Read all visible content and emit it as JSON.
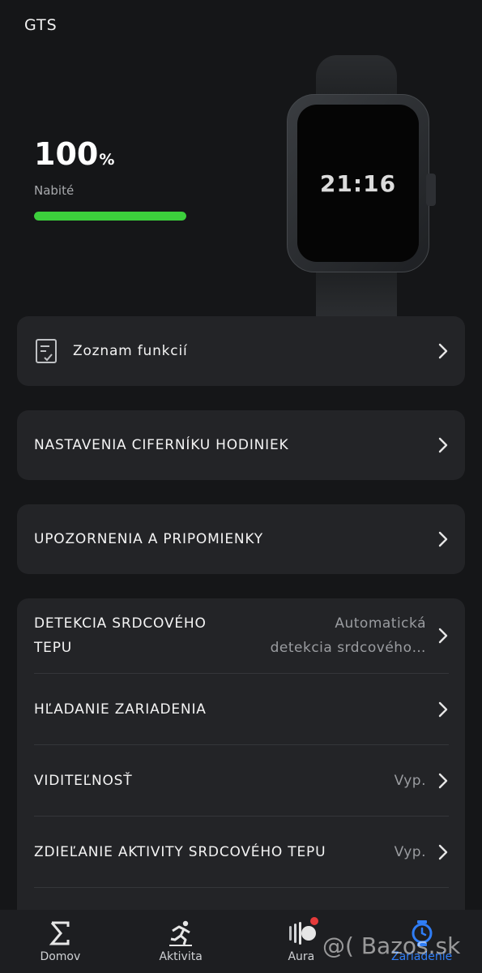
{
  "header": {
    "title": "GTS"
  },
  "battery": {
    "value": "100",
    "unit": "%",
    "label": "Nabité",
    "level": 1.0,
    "bar_color": "#3ccf3c"
  },
  "watch": {
    "time": "21:16"
  },
  "cards": {
    "features": {
      "label": "Zoznam funkcií"
    },
    "watchface": {
      "label": "NASTAVENIA CIFERNÍKU HODINIEK"
    },
    "notifications": {
      "label": "UPOZORNENIA A PRIPOMIENKY"
    }
  },
  "settings": {
    "heart_rate": {
      "label_line1": "DETEKCIA SRDCOVÉHO",
      "label_line2": "TEPU",
      "value_line1": "Automatická",
      "value_line2": "detekcia srdcového…"
    },
    "find_device": {
      "label": "HĽADANIE ZARIADENIA"
    },
    "visibility": {
      "label": "VIDITEĽNOSŤ",
      "value": "Vyp."
    },
    "share_hr": {
      "label": "ZDIEĽANIE AKTIVITY SRDCOVÉHO TEPU",
      "value": "Vyp."
    }
  },
  "nav": {
    "items": [
      {
        "label": "Domov",
        "icon": "sigma-icon"
      },
      {
        "label": "Aktivita",
        "icon": "runner-icon"
      },
      {
        "label": "Aura",
        "icon": "aura-icon"
      },
      {
        "label": "Zariadenie",
        "icon": "watch-icon"
      }
    ],
    "active_color": "#2f7df6"
  },
  "watermark": "@( Bazos.sk"
}
